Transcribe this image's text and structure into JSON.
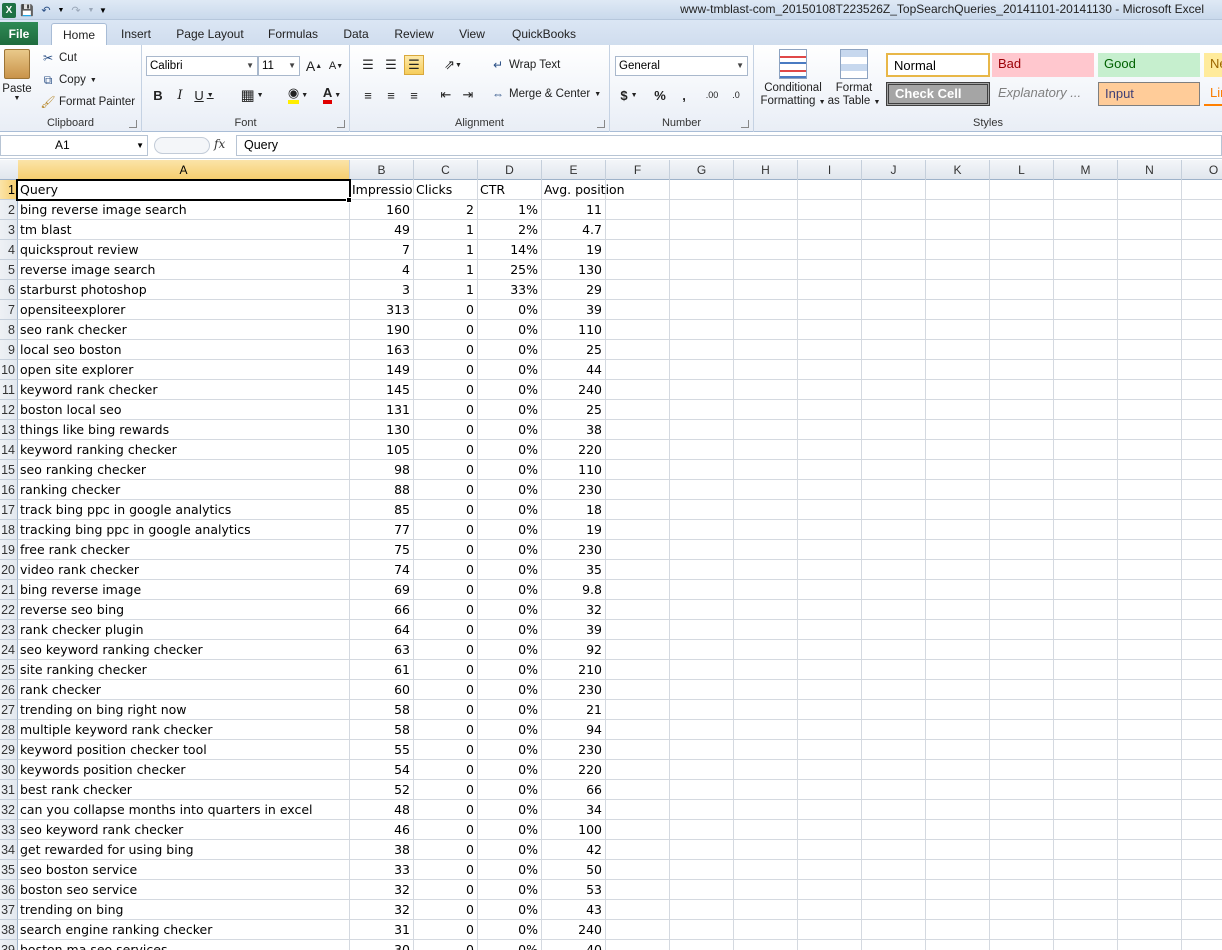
{
  "window": {
    "title": "www-tmblast-com_20150108T223526Z_TopSearchQueries_20141101-20141130  -  Microsoft Excel",
    "app_letter": "X"
  },
  "tabs": {
    "file": "File",
    "items": [
      "Home",
      "Insert",
      "Page Layout",
      "Formulas",
      "Data",
      "Review",
      "View",
      "QuickBooks"
    ]
  },
  "clipboard": {
    "paste": "Paste",
    "cut": "Cut",
    "copy": "Copy",
    "format_painter": "Format Painter",
    "label": "Clipboard"
  },
  "font": {
    "name": "Calibri",
    "size": "11",
    "label": "Font",
    "bold": "B",
    "italic": "I",
    "underline": "U",
    "grow": "A",
    "shrink": "A",
    "color_letter": "A"
  },
  "alignment": {
    "wrap_text": "Wrap Text",
    "merge_center": "Merge & Center",
    "label": "Alignment"
  },
  "number": {
    "format": "General",
    "currency": "$",
    "percent": "%",
    "comma": ",",
    "inc_dec": ".00",
    "dec_dec": ".0",
    "label": "Number"
  },
  "styles": {
    "conditional": "Conditional",
    "conditional2": "Formatting",
    "format_table": "Format",
    "format_table2": "as Table",
    "cells": [
      "Normal",
      "Bad",
      "Good",
      "Ne",
      "Check Cell",
      "Explanatory ...",
      "Input",
      "Lin"
    ],
    "label": "Styles"
  },
  "formula_bar": {
    "name_box": "A1",
    "fx": "fx",
    "content": "Query"
  },
  "columns": [
    "A",
    "B",
    "C",
    "D",
    "E",
    "F",
    "G",
    "H",
    "I",
    "J",
    "K",
    "L",
    "M",
    "N",
    "O"
  ],
  "headers": [
    "Query",
    "Impressions",
    "Clicks",
    "CTR",
    "Avg. position"
  ],
  "header_display": [
    "Query",
    "Impressio",
    "Clicks",
    "CTR",
    "Avg. position"
  ],
  "rows": [
    [
      "bing reverse image search",
      "160",
      "2",
      "1%",
      "11"
    ],
    [
      "tm blast",
      "49",
      "1",
      "2%",
      "4.7"
    ],
    [
      "quicksprout review",
      "7",
      "1",
      "14%",
      "19"
    ],
    [
      "reverse image search",
      "4",
      "1",
      "25%",
      "130"
    ],
    [
      "starburst photoshop",
      "3",
      "1",
      "33%",
      "29"
    ],
    [
      "opensiteexplorer",
      "313",
      "0",
      "0%",
      "39"
    ],
    [
      "seo rank checker",
      "190",
      "0",
      "0%",
      "110"
    ],
    [
      "local seo boston",
      "163",
      "0",
      "0%",
      "25"
    ],
    [
      "open site explorer",
      "149",
      "0",
      "0%",
      "44"
    ],
    [
      "keyword rank checker",
      "145",
      "0",
      "0%",
      "240"
    ],
    [
      "boston local seo",
      "131",
      "0",
      "0%",
      "25"
    ],
    [
      "things like bing rewards",
      "130",
      "0",
      "0%",
      "38"
    ],
    [
      "keyword ranking checker",
      "105",
      "0",
      "0%",
      "220"
    ],
    [
      "seo ranking checker",
      "98",
      "0",
      "0%",
      "110"
    ],
    [
      "ranking checker",
      "88",
      "0",
      "0%",
      "230"
    ],
    [
      "track bing ppc in google analytics",
      "85",
      "0",
      "0%",
      "18"
    ],
    [
      "tracking bing ppc in google analytics",
      "77",
      "0",
      "0%",
      "19"
    ],
    [
      "free rank checker",
      "75",
      "0",
      "0%",
      "230"
    ],
    [
      "video rank checker",
      "74",
      "0",
      "0%",
      "35"
    ],
    [
      "bing reverse image",
      "69",
      "0",
      "0%",
      "9.8"
    ],
    [
      "reverse seo bing",
      "66",
      "0",
      "0%",
      "32"
    ],
    [
      "rank checker plugin",
      "64",
      "0",
      "0%",
      "39"
    ],
    [
      "seo keyword ranking checker",
      "63",
      "0",
      "0%",
      "92"
    ],
    [
      "site ranking checker",
      "61",
      "0",
      "0%",
      "210"
    ],
    [
      "rank checker",
      "60",
      "0",
      "0%",
      "230"
    ],
    [
      "trending on bing right now",
      "58",
      "0",
      "0%",
      "21"
    ],
    [
      "multiple keyword rank checker",
      "58",
      "0",
      "0%",
      "94"
    ],
    [
      "keyword position checker tool",
      "55",
      "0",
      "0%",
      "230"
    ],
    [
      "keywords position checker",
      "54",
      "0",
      "0%",
      "220"
    ],
    [
      "best rank checker",
      "52",
      "0",
      "0%",
      "66"
    ],
    [
      "can you collapse months into quarters in excel",
      "48",
      "0",
      "0%",
      "34"
    ],
    [
      "seo keyword rank checker",
      "46",
      "0",
      "0%",
      "100"
    ],
    [
      "get rewarded for using bing",
      "38",
      "0",
      "0%",
      "42"
    ],
    [
      "seo boston service",
      "33",
      "0",
      "0%",
      "50"
    ],
    [
      "boston seo service",
      "32",
      "0",
      "0%",
      "53"
    ],
    [
      "trending on bing",
      "32",
      "0",
      "0%",
      "43"
    ],
    [
      "search engine ranking checker",
      "31",
      "0",
      "0%",
      "240"
    ],
    [
      "boston ma seo services",
      "30",
      "0",
      "0%",
      "40"
    ]
  ]
}
